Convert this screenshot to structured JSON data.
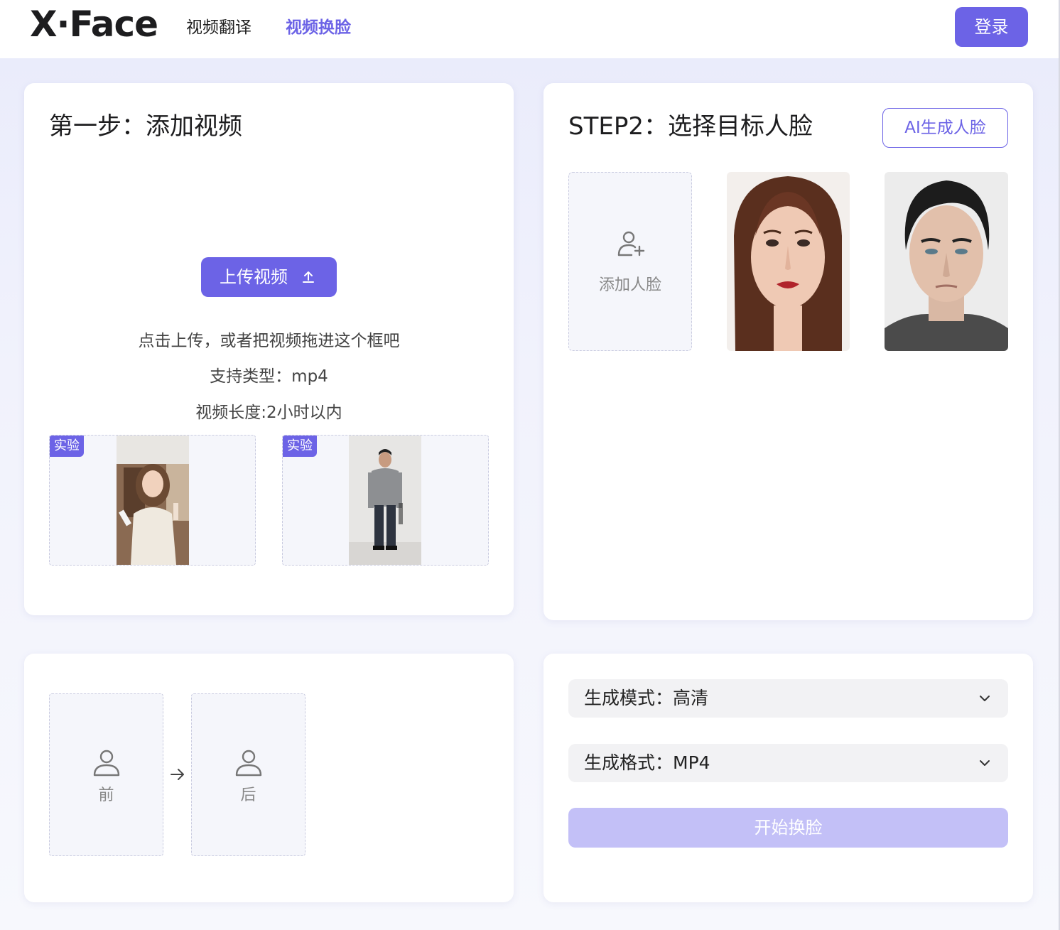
{
  "header": {
    "logo": "X·Face",
    "nav": [
      {
        "label": "视频翻译",
        "active": false
      },
      {
        "label": "视频换脸",
        "active": true
      }
    ],
    "login_label": "登录"
  },
  "step1": {
    "title": "第一步：添加视频",
    "upload_label": "上传视频",
    "hint_1": "点击上传，或者把视频拖进这个框吧",
    "hint_2": "支持类型：mp4",
    "hint_3": "视频长度:2小时以内",
    "samples": [
      {
        "badge": "实验",
        "icon": "video-thumbnail-woman"
      },
      {
        "badge": "实验",
        "icon": "video-thumbnail-man"
      }
    ]
  },
  "step2": {
    "title": "STEP2：选择目标人脸",
    "ai_face_label": "AI生成人脸",
    "add_face_label": "添加人脸",
    "faces": [
      {
        "icon": "face-woman-portrait"
      },
      {
        "icon": "face-man-portrait"
      }
    ]
  },
  "preview": {
    "before_label": "前",
    "after_label": "后"
  },
  "settings": {
    "mode_label": "生成模式：高清",
    "format_label": "生成格式：MP4",
    "start_label": "开始换脸"
  },
  "colors": {
    "accent": "#6c63e6",
    "accent_disabled": "#c3c0f7"
  }
}
